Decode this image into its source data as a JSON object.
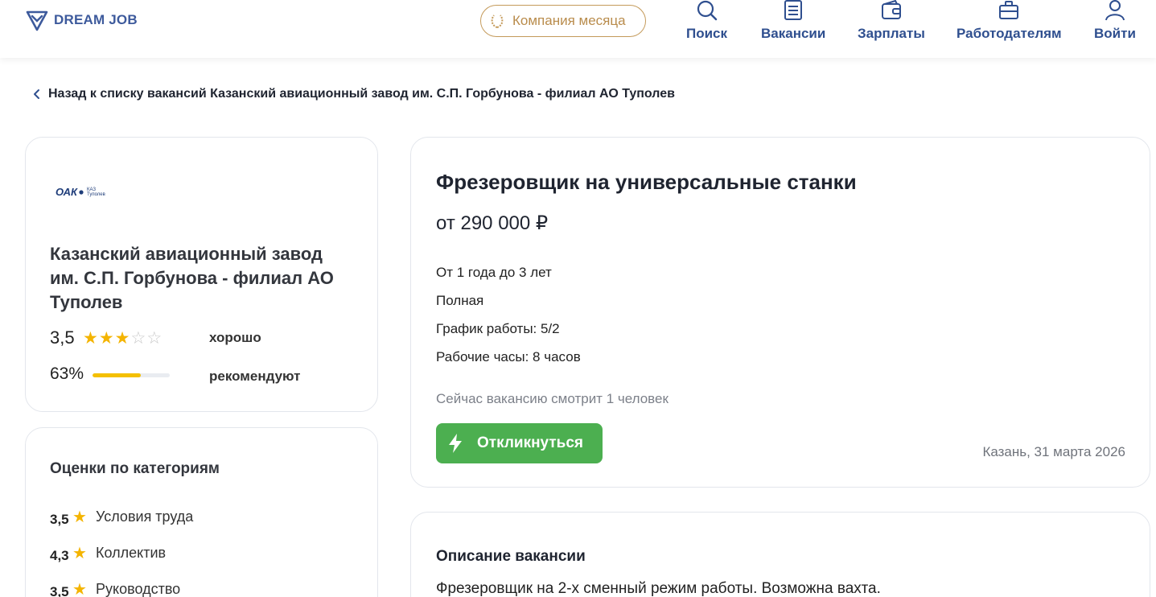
{
  "header": {
    "logo_text": "DREAM JOB",
    "company_month": "Компания месяца",
    "nav": [
      {
        "label": "Поиск",
        "icon": "search-icon"
      },
      {
        "label": "Вакансии",
        "icon": "document-icon"
      },
      {
        "label": "Зарплаты",
        "icon": "wallet-icon"
      },
      {
        "label": "Работодателям",
        "icon": "briefcase-icon"
      },
      {
        "label": "Войти",
        "icon": "user-icon"
      }
    ]
  },
  "back_link": "Назад к списку вакансий Казанский авиационный завод им. С.П. Горбунова - филиал АО Туполев",
  "company": {
    "logo_main": "ОАК",
    "logo_sub1": "КАЗ",
    "logo_sub2": "Туполев",
    "name": "Казанский авиационный завод им. С.П. Горбунова - филиал АО Туполев",
    "rating": "3,5",
    "stars_filled": 3,
    "stars_total": 5,
    "rating_word": "хорошо",
    "recommend_percent": "63%",
    "recommend_fraction": 0.63,
    "recommend_label": "рекомендуют"
  },
  "categories": {
    "title": "Оценки по категориям",
    "items": [
      {
        "score": "3,5",
        "name": "Условия труда"
      },
      {
        "score": "4,3",
        "name": "Коллектив"
      },
      {
        "score": "3,5",
        "name": "Руководство"
      }
    ]
  },
  "vacancy": {
    "title": "Фрезеровщик на универсальные станки",
    "salary": "от 290 000 ₽",
    "details": [
      "От 1 года до 3 лет",
      "Полная",
      "График работы: 5/2",
      "Рабочие часы: 8 часов"
    ],
    "viewers": "Сейчас вакансию смотрит 1 человек",
    "apply_label": "Откликнуться",
    "location_date": "Казань, 31 марта 2026"
  },
  "description": {
    "title": "Описание вакансии",
    "text": "Фрезеровщик на 2-х сменный режим работы. Возможна вахта."
  },
  "colors": {
    "brand": "#3d5a9c",
    "accent_gold": "#c49a5a",
    "star": "#f4b400",
    "apply": "#4caf50"
  }
}
